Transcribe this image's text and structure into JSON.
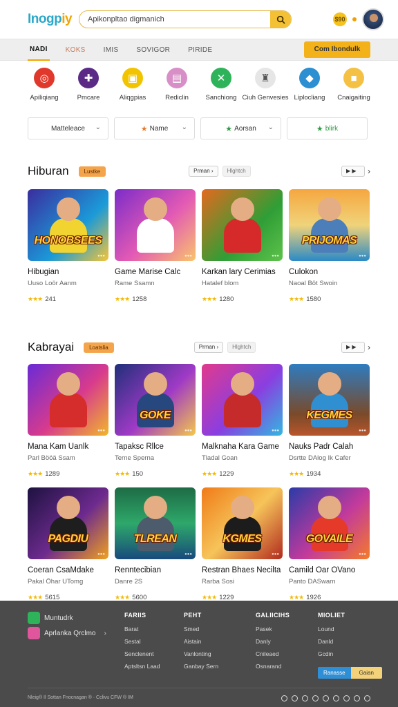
{
  "header": {
    "logo_main": "Inogp",
    "logo_accent": "iy",
    "search_placeholder": "Apikonpltao digmanich",
    "coin_label": "$90"
  },
  "nav": {
    "tabs": [
      "NADI",
      "KOKS",
      "IMIS",
      "SOVIGOR",
      "PIRIDE"
    ],
    "cta": "Com Ibondulk"
  },
  "categories": [
    {
      "label": "Apiliqiang",
      "icon": "target-icon",
      "color": "#e0382b"
    },
    {
      "label": "Pmcare",
      "icon": "gamepad-icon",
      "color": "#5b2a86"
    },
    {
      "label": "Aliqgpias",
      "icon": "controller-icon",
      "color": "#f2c400"
    },
    {
      "label": "Rediclin",
      "icon": "cassette-icon",
      "color": "#d88fc7"
    },
    {
      "label": "Sanchiong",
      "icon": "swords-icon",
      "color": "#2fb35a"
    },
    {
      "label": "Ciuh Genvesies",
      "icon": "castle-icon",
      "color": "#e6e6e6"
    },
    {
      "label": "Liplocliang",
      "icon": "puzzle-icon",
      "color": "#2b8fd1"
    },
    {
      "label": "Cnaigaiting",
      "icon": "gift-icon",
      "color": "#f4c144"
    }
  ],
  "filters": [
    {
      "label": "Matteleace",
      "star": "",
      "chevron": true
    },
    {
      "label": "Name",
      "star": "orange",
      "chevron": true
    },
    {
      "label": "Aorsan",
      "star": "green",
      "chevron": true
    },
    {
      "label": "blirk",
      "star": "green",
      "chevron": false
    }
  ],
  "sections": [
    {
      "title": "Hiburan",
      "badge": "Lustke",
      "pill_left": "Prman",
      "pill_right": "Hlghtch",
      "cards": [
        {
          "name": "Hibugian",
          "sub": "Uuso Loör Aanm",
          "rating": "241",
          "art": "HONOBSEES",
          "bg": "linear-gradient(135deg,#3a2d9e,#1b9ad8 60%,#f6c435)",
          "shirt": "#f2d431"
        },
        {
          "name": "Game Marise Calc",
          "sub": "Rame Ssamn",
          "rating": "1258",
          "art": "",
          "bg": "linear-gradient(135deg,#7b2cc9,#e35ab4 55%,#f9c46a)",
          "shirt": "#ffffff"
        },
        {
          "name": "Karkan lary Cerimias",
          "sub": "Hatalef blom",
          "rating": "1280",
          "art": "",
          "bg": "linear-gradient(135deg,#e36a1e,#2f9e36 60%,#5ec24b)",
          "shirt": "#d62a2a"
        },
        {
          "name": "Culokon",
          "sub": "Naoal Böt Swoin",
          "rating": "1580",
          "art": "PRIJOMAS",
          "bg": "linear-gradient(180deg,#f5a740,#f0d37a 50%,#2b8ac6)",
          "shirt": "#4c7fb9"
        }
      ]
    },
    {
      "title": "Kabrayai",
      "badge": "Loatslia",
      "pill_left": "Prman",
      "pill_right": "Hlghtch",
      "cards": [
        {
          "name": "Mana Kam Uanlk",
          "sub": "Parl Bööä Ssam",
          "rating": "1289",
          "art": "",
          "bg": "linear-gradient(135deg,#6a2bd6,#d83b8c 55%,#f0b72a)",
          "shirt": "#d52c2c"
        },
        {
          "name": "Tapaksc Rllce",
          "sub": "Terne Sperna",
          "rating": "150",
          "art": "GOKE",
          "bg": "linear-gradient(135deg,#1f2f7a,#a03ac6 55%,#f3c84a)",
          "shirt": "#27477f"
        },
        {
          "name": "Malknaha Kara Game",
          "sub": "Tladal Goan",
          "rating": "1229",
          "art": "",
          "bg": "linear-gradient(135deg,#e23a8c,#8a3ee0 55%,#33b7e0)",
          "shirt": "#c52b2b"
        },
        {
          "name": "Nauks Padr Calah",
          "sub": "Dsrtte DAlog Ik Cafer",
          "rating": "1934",
          "art": "KEGMES",
          "bg": "linear-gradient(180deg,#2e7cc0,#7a4a2a 70%,#b8562c)",
          "shirt": "#2f8fd1"
        }
      ]
    },
    {
      "title": "",
      "cards": [
        {
          "name": "Coeran CsaMdake",
          "sub": "Pakal Öhar UTomg",
          "rating": "5615",
          "art": "PAGDIU",
          "bg": "linear-gradient(135deg,#1d1240,#6d2a8e 55%,#f0a11e)",
          "shirt": "#1e1e1e"
        },
        {
          "name": "Renntecibian",
          "sub": "Danre 2S",
          "rating": "5600",
          "art": "TLREAN",
          "bg": "linear-gradient(180deg,#1e6b45,#2ea86a 50%,#184a7c)",
          "shirt": "#4d5c6c"
        },
        {
          "name": "Restran Bhaes Necilta",
          "sub": "Rarba Sosi",
          "rating": "1229",
          "art": "KGMES",
          "bg": "linear-gradient(135deg,#f07b18,#f6c45a 50%,#b12a1e)",
          "shirt": "#1c1c1c"
        },
        {
          "name": "Camild Oar OVano",
          "sub": "Panto DASwarn",
          "rating": "1926",
          "art": "GOVAILE",
          "bg": "linear-gradient(135deg,#2a3ba8,#c23a9c 55%,#f47b2a)",
          "shirt": "#e53a2a"
        }
      ]
    }
  ],
  "footer": {
    "apps": [
      {
        "label": "Muntudrk",
        "color": "#2fb35a"
      },
      {
        "label": "Aprlanka Qrclmo",
        "color": "#e0569c"
      }
    ],
    "columns": [
      {
        "heading": "FARIIS",
        "links": [
          "Barat",
          "Sestal",
          "Senclenent",
          "Aptsltsn Laad"
        ]
      },
      {
        "heading": "PEHT",
        "links": [
          "Smed",
          "Aistain",
          "Vanlonting",
          "Ganbay Sern"
        ]
      },
      {
        "heading": "GALIICIHS",
        "links": [
          "Pasek",
          "Danly",
          "Cnileaed",
          "Osnarand"
        ]
      },
      {
        "heading": "MIOLIET",
        "links": [
          "Lound",
          "Danld",
          "Gcdin"
        ]
      }
    ],
    "btn_primary": "Ranasse",
    "btn_secondary": "Gaian",
    "copyright": "Nleig® Il Sottan Fnocnagan ® · Cclivu CFW ® IM"
  }
}
